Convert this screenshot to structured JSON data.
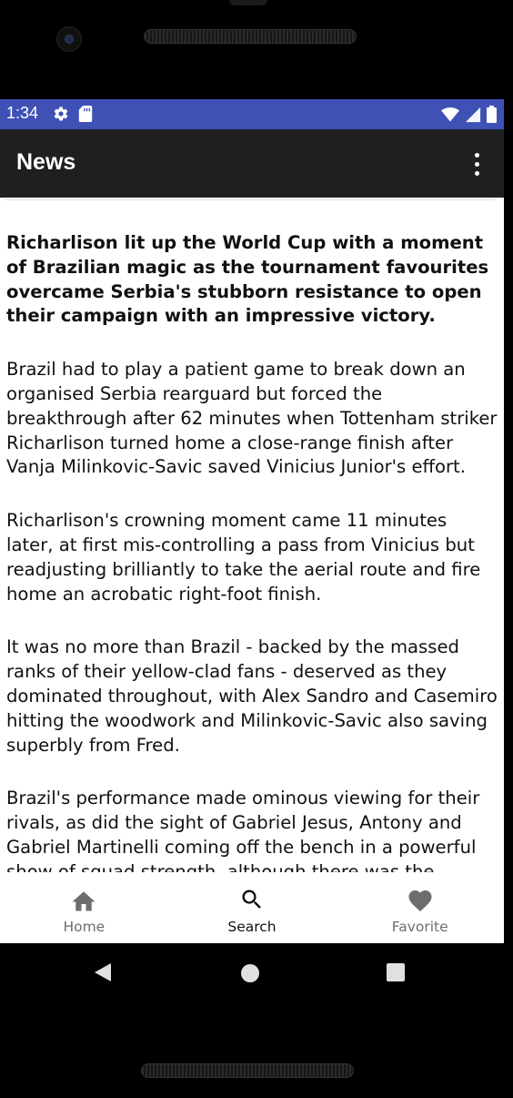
{
  "status_bar": {
    "time": "1:34",
    "background": "#3f51b5",
    "left_icons": [
      "gear-icon",
      "sd-card-icon"
    ],
    "right_icons": [
      "wifi-icon",
      "cell-signal-icon",
      "battery-icon"
    ]
  },
  "app_bar": {
    "title": "News",
    "menu_icon": "more-vert-icon",
    "background": "#1f1f1f"
  },
  "article": {
    "lead": "Richarlison lit up the World Cup with a moment of Brazilian magic as the tournament favourites overcame Serbia's stubborn resistance to open their campaign with an impressive victory.",
    "paragraphs": [
      "Brazil had to play a patient game to break down an organised Serbia rearguard but forced the breakthrough after 62 minutes when Tottenham striker Richarlison turned home a close-range finish after Vanja Milinkovic-Savic saved Vinicius Junior's effort.",
      "Richarlison's crowning moment came 11 minutes later, at first mis-controlling a pass from Vinicius but readjusting brilliantly to take the aerial route and fire home an acrobatic right-foot finish.",
      "It was no more than Brazil - backed by the massed ranks of their yellow-clad fans - deserved as they dominated throughout, with Alex Sandro and Casemiro hitting the woodwork and Milinkovic-Savic also saving superbly from Fred.",
      "Brazil's performance made ominous viewing for their rivals, as did the sight of Gabriel Jesus, Antony and Gabriel Martinelli coming off the bench in a powerful show of squad strength, although there was the worrying"
    ]
  },
  "bottom_nav": {
    "items": [
      {
        "label": "Home",
        "icon": "home-icon",
        "active": false
      },
      {
        "label": "Search",
        "icon": "search-icon",
        "active": true
      },
      {
        "label": "Favorite",
        "icon": "heart-icon",
        "active": false
      }
    ]
  },
  "system_nav": {
    "buttons": [
      "back-icon",
      "home-circle-icon",
      "recents-square-icon"
    ]
  }
}
